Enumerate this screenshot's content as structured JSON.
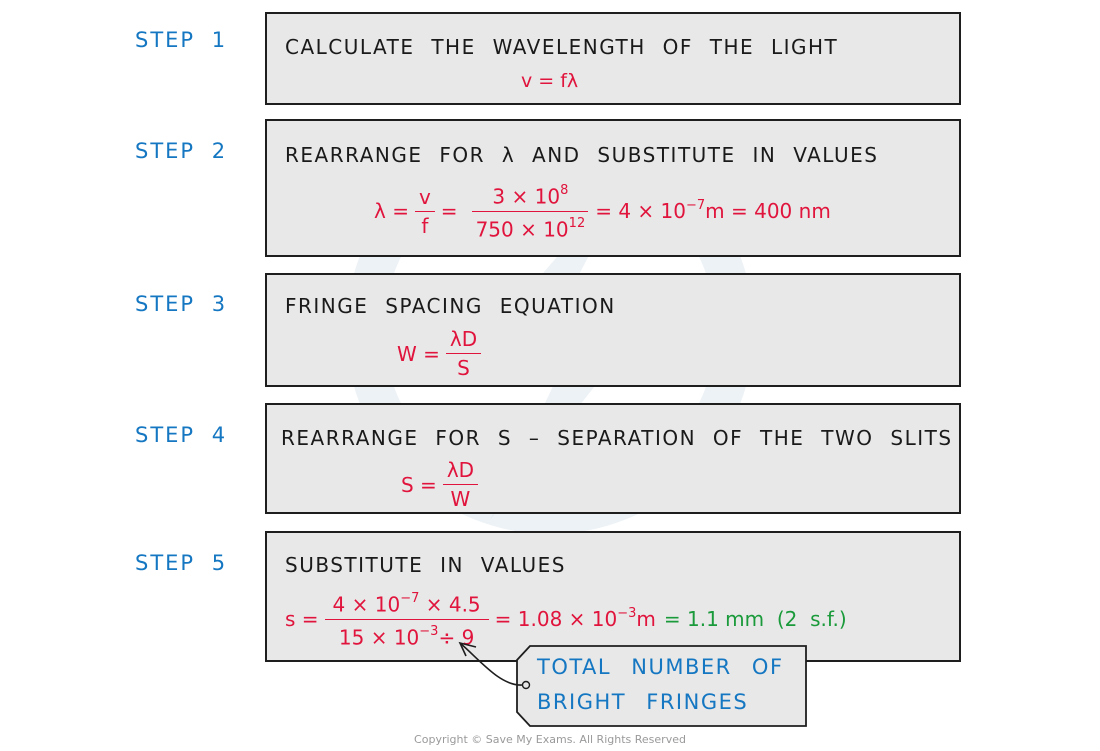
{
  "steps": [
    {
      "label": "STEP 1",
      "heading": "CALCULATE THE WAVELENGTH OF THE LIGHT",
      "equation": "v = fλ"
    },
    {
      "label": "STEP 2",
      "heading": "REARRANGE FOR λ AND SUBSTITUTE IN VALUES",
      "equation": {
        "lhs": "λ =",
        "frac1_num": "v",
        "frac1_den": "f",
        "eq1": "=",
        "frac2_num_base": "3 × 10",
        "frac2_num_exp": "8",
        "frac2_den_base": "750 × 10",
        "frac2_den_exp": "12",
        "rhs1_base": "= 4 × 10",
        "rhs1_exp": "−7",
        "rhs1_unit": "m = 400 nm"
      }
    },
    {
      "label": "STEP 3",
      "heading": "FRINGE SPACING EQUATION",
      "equation": {
        "lhs": "W =",
        "num": "λD",
        "den": "S"
      }
    },
    {
      "label": "STEP 4",
      "heading": "REARRANGE FOR S – SEPARATION OF THE TWO SLITS",
      "equation": {
        "lhs": "S =",
        "num": "λD",
        "den": "W"
      }
    },
    {
      "label": "STEP 5",
      "heading": "SUBSTITUTE IN VALUES",
      "equation": {
        "lhs": "s =",
        "num_a": "4 × 10",
        "num_exp": "−7",
        "num_b": " × 4.5",
        "den_a": "15 × 10",
        "den_exp": "−3",
        "den_b": "÷ 9",
        "rhs_base": "= 1.08 × 10",
        "rhs_exp": "−3",
        "rhs_unit": "m",
        "result": "= 1.1 mm  (2  s.f.)"
      }
    }
  ],
  "callout": {
    "line1": "TOTAL NUMBER OF",
    "line2": "BRIGHT FRINGES"
  },
  "copyright": "Copyright © Save My Exams. All Rights Reserved",
  "colors": {
    "step_label": "#1577c2",
    "equation": "#e0143c",
    "result": "#1a9a3a",
    "box_fill": "#e8e8e8",
    "box_border": "#1e1e1e"
  }
}
